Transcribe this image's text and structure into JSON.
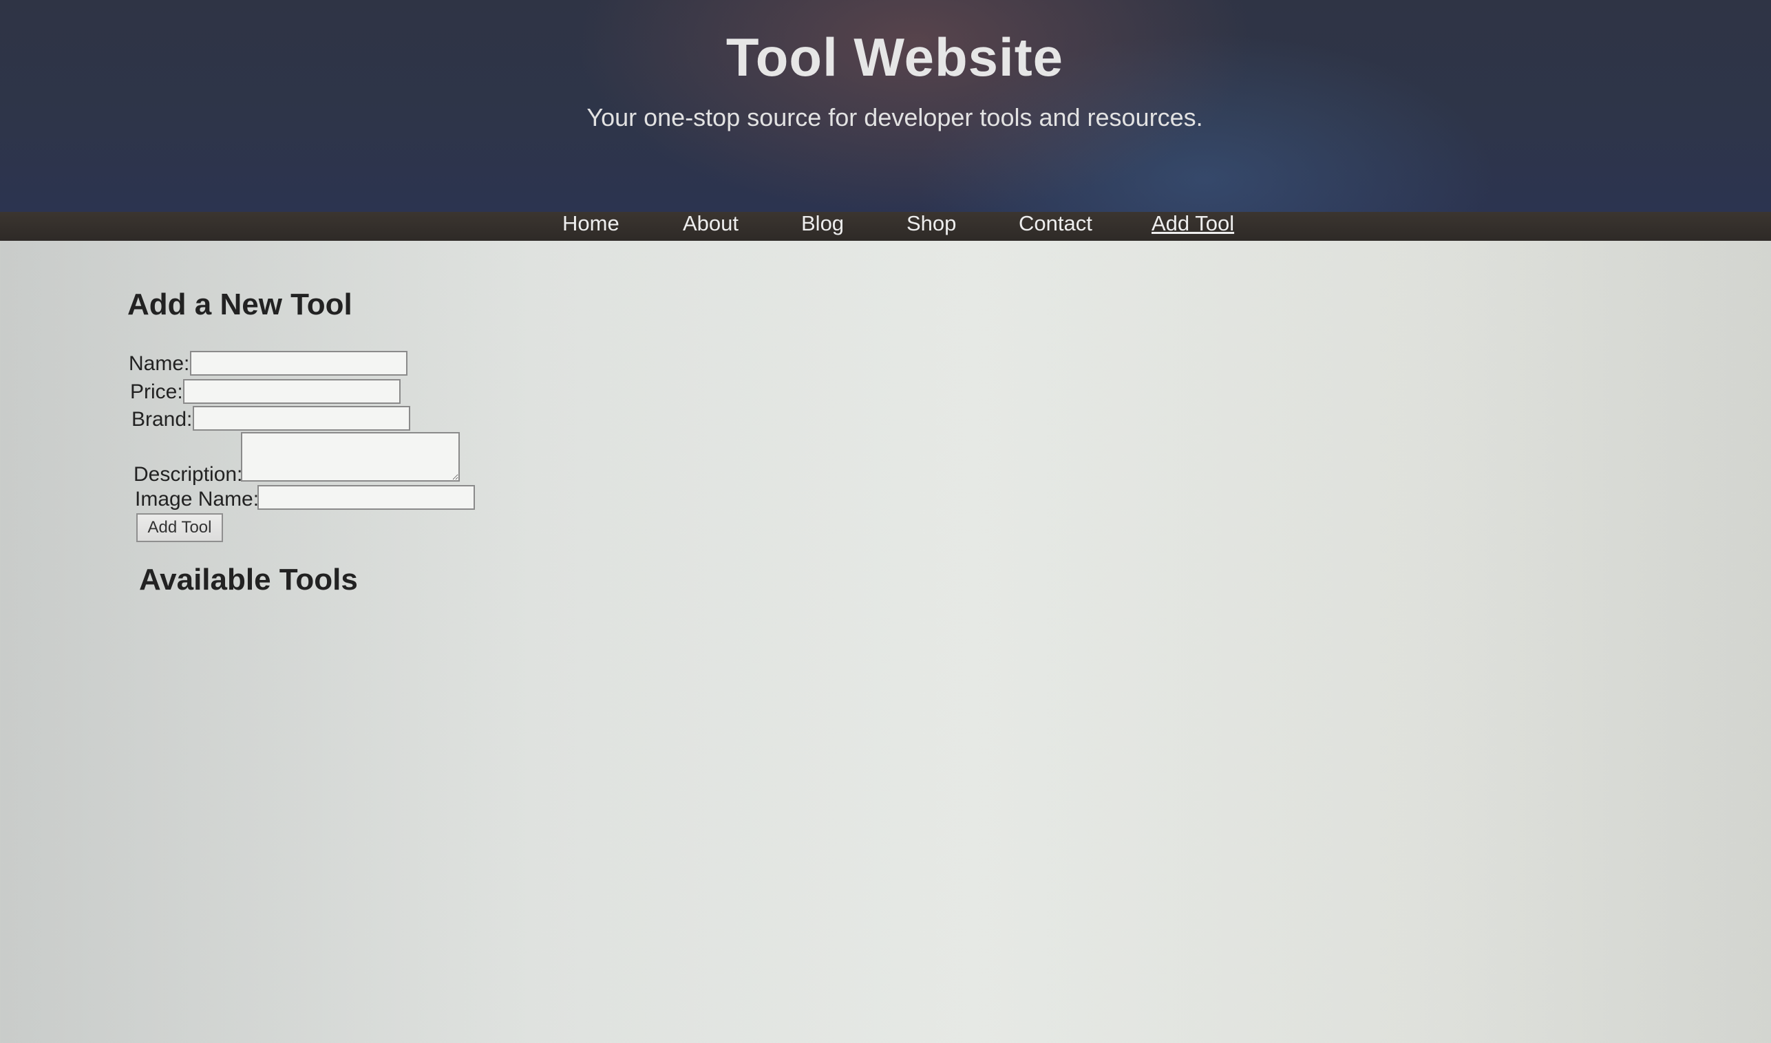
{
  "header": {
    "title": "Tool Website",
    "tagline": "Your one-stop source for developer tools and resources."
  },
  "nav": {
    "items": [
      {
        "label": "Home"
      },
      {
        "label": "About"
      },
      {
        "label": "Blog"
      },
      {
        "label": "Shop"
      },
      {
        "label": "Contact"
      },
      {
        "label": "Add Tool",
        "active": true
      }
    ]
  },
  "form": {
    "heading": "Add a New Tool",
    "name_label": "Name:",
    "name_value": "",
    "price_label": "Price:",
    "price_value": "",
    "brand_label": "Brand:",
    "brand_value": "",
    "description_label": "Description:",
    "description_value": "",
    "image_label": "Image Name:",
    "image_value": "",
    "submit_label": "Add Tool"
  },
  "tools": {
    "heading": "Available Tools",
    "items": []
  }
}
